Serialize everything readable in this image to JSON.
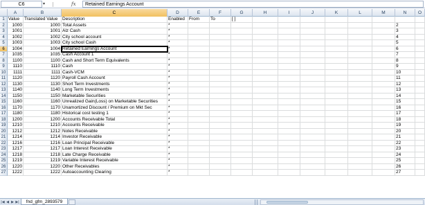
{
  "formula_bar": {
    "name_box": "C6",
    "formula_icon": "fx",
    "content": "Retained Earnings Account"
  },
  "columns": [
    "A",
    "B",
    "C",
    "D",
    "E",
    "F",
    "G",
    "H",
    "I",
    "J",
    "K",
    "L",
    "M",
    "N",
    "O"
  ],
  "active_column": "C",
  "active_row": "6",
  "header_row": {
    "a": "Value",
    "b": "Translated Value",
    "c": "Description",
    "d": "Enabled",
    "e": "From",
    "f": "To",
    "g": "[ ]"
  },
  "rows": [
    {
      "n": "2",
      "a": "1000",
      "b": "1000",
      "c": "Total Assets",
      "d": "*"
    },
    {
      "n": "3",
      "a": "1001",
      "b": "1001",
      "c": "Alz Cash",
      "d": "*"
    },
    {
      "n": "4",
      "a": "1002",
      "b": "1002",
      "c": "City school account",
      "d": "*"
    },
    {
      "n": "5",
      "a": "1003",
      "b": "1003",
      "c": "City school Cash",
      "d": "*"
    },
    {
      "n": "6",
      "a": "1004",
      "b": "1004",
      "c": "Retained Earnings Account",
      "d": "*"
    },
    {
      "n": "7",
      "a": "1035",
      "b": "1035",
      "c": "Cash Account 1",
      "d": "*"
    },
    {
      "n": "8",
      "a": "1100",
      "b": "1100",
      "c": "Cash and Short Term Equivalents",
      "d": "*"
    },
    {
      "n": "9",
      "a": "1110",
      "b": "1110",
      "c": "Cash",
      "d": "*"
    },
    {
      "n": "10",
      "a": "1111",
      "b": "1111",
      "c": "Cash-VCM",
      "d": "*"
    },
    {
      "n": "11",
      "a": "1120",
      "b": "1120",
      "c": "Payroll Cash Account",
      "d": "*"
    },
    {
      "n": "12",
      "a": "1130",
      "b": "1130",
      "c": "Short Term Investments",
      "d": "*"
    },
    {
      "n": "13",
      "a": "1140",
      "b": "1140",
      "c": "Long Term Investments",
      "d": "*"
    },
    {
      "n": "14",
      "a": "1150",
      "b": "1150",
      "c": "Marketable Securities",
      "d": "*"
    },
    {
      "n": "15",
      "a": "1160",
      "b": "1160",
      "c": "Unrealized Gain(Loss) on Marketable Securities",
      "d": "*"
    },
    {
      "n": "16",
      "a": "1170",
      "b": "1170",
      "c": "Unamortized Discount / Premium on Mkt Sec",
      "d": "*"
    },
    {
      "n": "17",
      "a": "1180",
      "b": "1180",
      "c": "Historical cost testing 1",
      "d": "*"
    },
    {
      "n": "18",
      "a": "1200",
      "b": "1200",
      "c": "Accounts Receivable Total",
      "d": "*"
    },
    {
      "n": "19",
      "a": "1210",
      "b": "1210",
      "c": "Accounts Receivable",
      "d": "*"
    },
    {
      "n": "20",
      "a": "1212",
      "b": "1212",
      "c": "Notes Receivable",
      "d": "*"
    },
    {
      "n": "21",
      "a": "1214",
      "b": "1214",
      "c": "Investor Receivable",
      "d": "*"
    },
    {
      "n": "22",
      "a": "1216",
      "b": "1216",
      "c": "Loan Principal Receivable",
      "d": "*"
    },
    {
      "n": "23",
      "a": "1217",
      "b": "1217",
      "c": "Loan Interest Receivable",
      "d": "*"
    },
    {
      "n": "24",
      "a": "1218",
      "b": "1218",
      "c": "Late Charge Receivable",
      "d": "*"
    },
    {
      "n": "25",
      "a": "1219",
      "b": "1219",
      "c": "Variable Interest Receivable",
      "d": "*"
    },
    {
      "n": "26",
      "a": "1220",
      "b": "1220",
      "c": "Other Receivables",
      "d": "*"
    },
    {
      "n": "27",
      "a": "1222",
      "b": "1222",
      "c": "Autoaccounting Clearing",
      "d": "*"
    }
  ],
  "sheet_tab": "fnd_gfm_2893579"
}
